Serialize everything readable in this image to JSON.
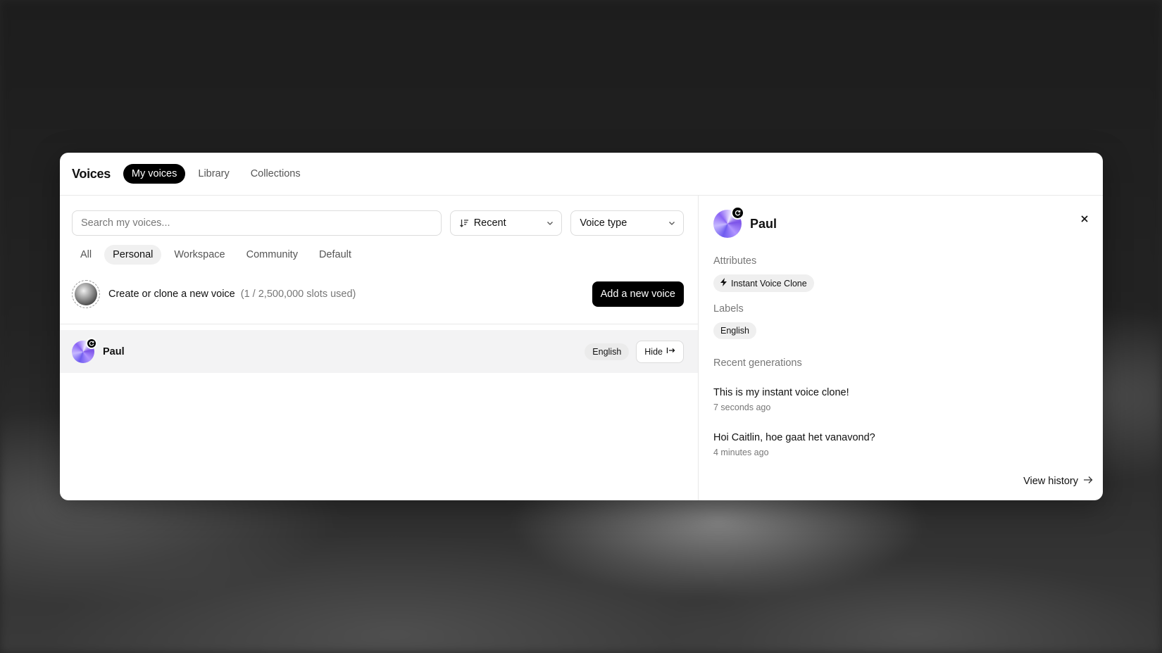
{
  "header": {
    "title": "Voices",
    "tabs": [
      {
        "label": "My voices",
        "active": true
      },
      {
        "label": "Library",
        "active": false
      },
      {
        "label": "Collections",
        "active": false
      }
    ]
  },
  "toolbar": {
    "search_placeholder": "Search my voices...",
    "sort": {
      "selected": "Recent",
      "icon": "sort-icon"
    },
    "voice_type": {
      "selected": "Voice type"
    }
  },
  "filters": [
    {
      "label": "All",
      "active": false
    },
    {
      "label": "Personal",
      "active": true
    },
    {
      "label": "Workspace",
      "active": false
    },
    {
      "label": "Community",
      "active": false
    },
    {
      "label": "Default",
      "active": false
    }
  ],
  "create": {
    "label": "Create or clone a new voice",
    "slots": "(1 / 2,500,000 slots used)",
    "button": "Add a new voice"
  },
  "voices": [
    {
      "name": "Paul",
      "language": "English",
      "hide_label": "Hide"
    }
  ],
  "detail": {
    "name": "Paul",
    "attributes_label": "Attributes",
    "attribute": "Instant Voice Clone",
    "labels_label": "Labels",
    "label": "English",
    "recent_label": "Recent generations",
    "generations": [
      {
        "text": "This is my instant voice clone!",
        "time": "7 seconds ago"
      },
      {
        "text": "Hoi Caitlin, hoe gaat het vanavond?",
        "time": "4 minutes ago"
      }
    ],
    "view_history": "View history"
  },
  "colors": {
    "accent": "#000000",
    "selected_row": "#f3f3f4",
    "avatar_purple": "#8a63f5"
  }
}
